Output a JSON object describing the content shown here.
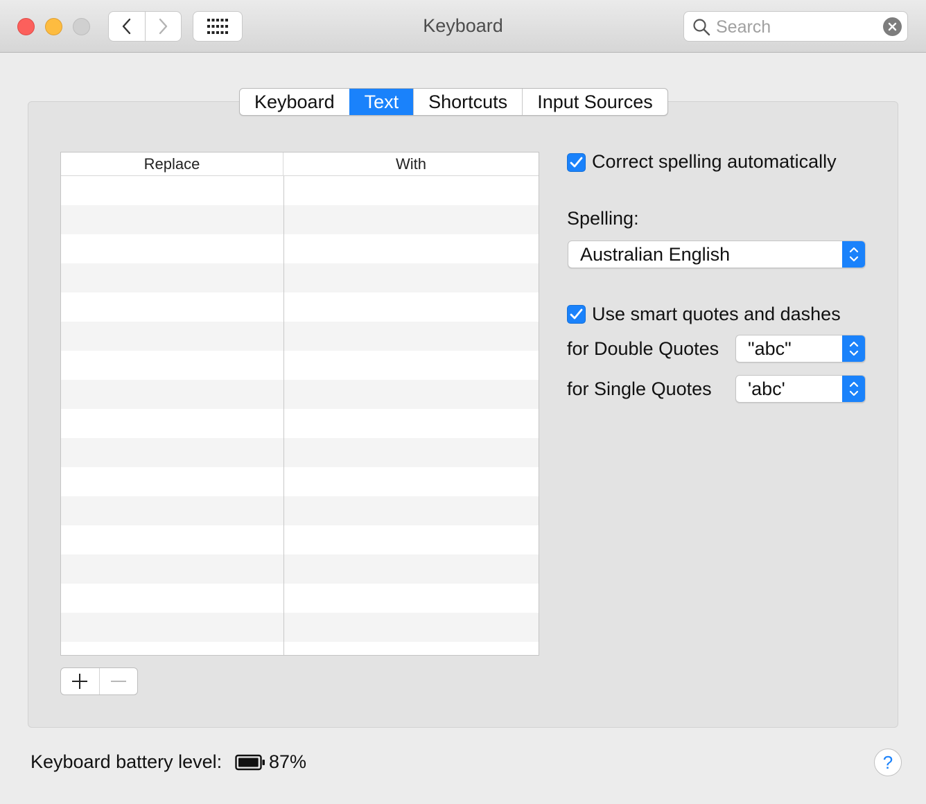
{
  "window": {
    "title": "Keyboard",
    "search_placeholder": "Search"
  },
  "tabs": [
    {
      "label": "Keyboard",
      "active": false
    },
    {
      "label": "Text",
      "active": true
    },
    {
      "label": "Shortcuts",
      "active": false
    },
    {
      "label": "Input Sources",
      "active": false
    }
  ],
  "table": {
    "columns": [
      "Replace",
      "With"
    ],
    "rows": []
  },
  "text_options": {
    "correct_spelling": {
      "label": "Correct spelling automatically",
      "checked": true
    },
    "spelling_label": "Spelling:",
    "spelling_value": "Australian English",
    "smart_quotes": {
      "label": "Use smart quotes and dashes",
      "checked": true
    },
    "double_quotes_label": "for Double Quotes",
    "double_quotes_value": "\"abc\"",
    "single_quotes_label": "for Single Quotes",
    "single_quotes_value": "'abc'"
  },
  "footer": {
    "battery_label": "Keyboard battery level:",
    "battery_percent": "87%",
    "battery_level": 0.87,
    "help_label": "?"
  },
  "colors": {
    "accent": "#1a82fb",
    "close": "#fc605c",
    "minimize": "#fdbc40",
    "zoom_disabled": "#d0d0d0"
  }
}
